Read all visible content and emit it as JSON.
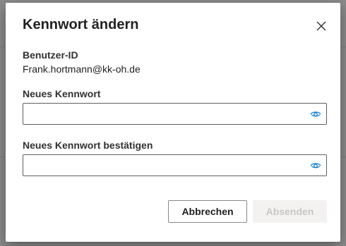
{
  "dialog": {
    "title": "Kennwort ändern",
    "close_icon": "close-icon",
    "user_id_label": "Benutzer-ID",
    "user_id_value": "Frank.hortmann@kk-oh.de",
    "new_password_label": "Neues Kennwort",
    "new_password_value": "",
    "confirm_password_label": "Neues Kennwort bestätigen",
    "confirm_password_value": "",
    "reveal_icon": "eye-icon",
    "cancel_label": "Abbrechen",
    "submit_label": "Absenden",
    "submit_enabled": false
  },
  "colors": {
    "accent": "#0078d4",
    "field_border": "#5f5f5f",
    "disabled_bg": "#f3f2f1",
    "disabled_text": "#c8c6c4"
  }
}
